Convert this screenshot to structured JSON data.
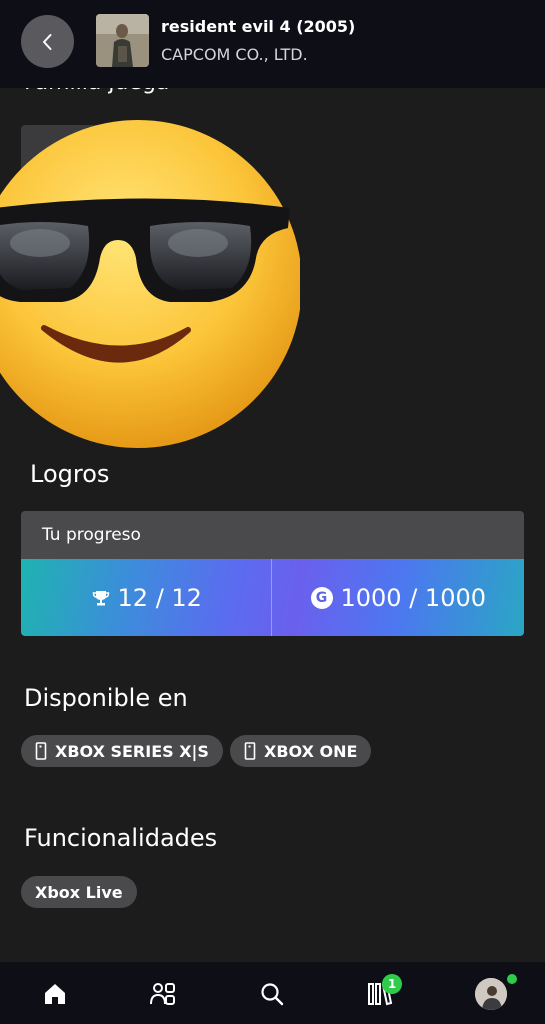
{
  "header": {
    "title": "resident evil 4 (2005)",
    "publisher": "CAPCOM CO., LTD.",
    "back_icon": "chevron-left-icon"
  },
  "partial_section": {
    "heading": "Familia juega"
  },
  "achievements": {
    "heading": "Logros",
    "card_title": "Tu progreso",
    "achievements_value": "12 / 12",
    "gamerscore_value": "1000 / 1000",
    "gamerscore_badge": "G"
  },
  "available": {
    "heading": "Disponible en",
    "platforms": [
      "XBOX SERIES X|S",
      "XBOX ONE"
    ]
  },
  "features": {
    "heading": "Funcionalidades",
    "items": [
      "Xbox Live"
    ]
  },
  "nav": {
    "library_badge": "1",
    "items": [
      "home-icon",
      "social-icon",
      "search-icon",
      "library-icon",
      "profile-avatar"
    ]
  },
  "colors": {
    "header_bg": "#0e0e17",
    "page_bg": "#1c1c1c",
    "chip_bg": "#4a4a4c",
    "status_green": "#2ecc4a"
  }
}
